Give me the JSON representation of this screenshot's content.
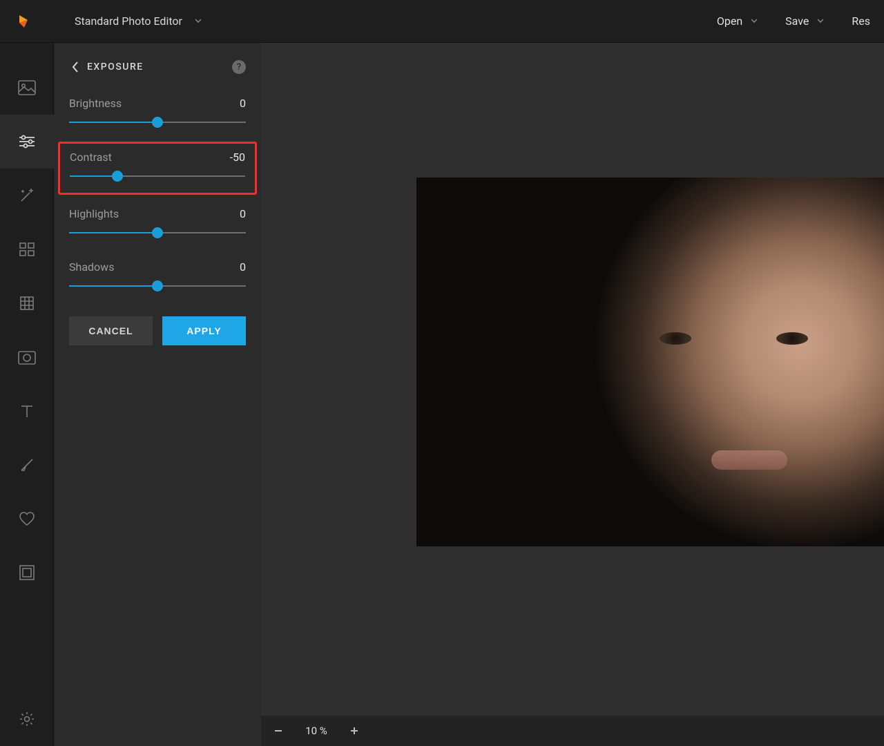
{
  "header": {
    "app_name": "Standard Photo Editor",
    "open_label": "Open",
    "save_label": "Save",
    "reset_label": "Res"
  },
  "panel": {
    "title": "EXPOSURE",
    "cancel_label": "CANCEL",
    "apply_label": "APPLY"
  },
  "sliders": [
    {
      "label": "Brightness",
      "value": "0",
      "pos_pct": 50,
      "highlighted": false
    },
    {
      "label": "Contrast",
      "value": "-50",
      "pos_pct": 27,
      "highlighted": true
    },
    {
      "label": "Highlights",
      "value": "0",
      "pos_pct": 50,
      "highlighted": false
    },
    {
      "label": "Shadows",
      "value": "0",
      "pos_pct": 50,
      "highlighted": false
    }
  ],
  "zoom": {
    "value": "10 %"
  },
  "colors": {
    "accent": "#1ea6e6",
    "highlight_border": "#ff2a2a"
  }
}
